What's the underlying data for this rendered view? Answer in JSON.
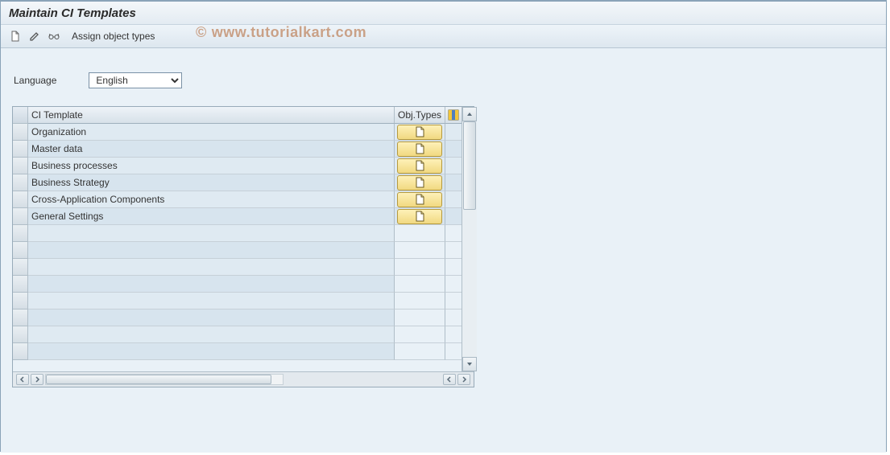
{
  "header": {
    "title": "Maintain CI Templates"
  },
  "toolbar": {
    "assign_label": "Assign object types"
  },
  "language": {
    "label": "Language",
    "selected": "English",
    "options": [
      "English"
    ]
  },
  "table": {
    "columns": {
      "template": "CI Template",
      "obj_types": "Obj.Types"
    },
    "rows": [
      {
        "template": "Organization"
      },
      {
        "template": "Master data"
      },
      {
        "template": "Business processes"
      },
      {
        "template": "Business Strategy"
      },
      {
        "template": "Cross-Application Components"
      },
      {
        "template": "General Settings"
      }
    ],
    "empty_rows": 8
  },
  "watermark": "www.tutorialkart.com",
  "watermark_copy": "©"
}
